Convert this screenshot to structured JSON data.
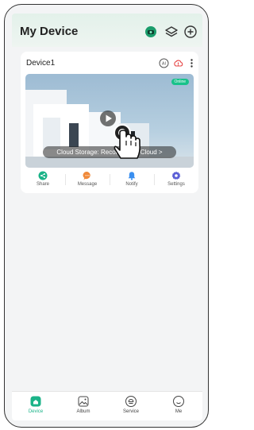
{
  "header": {
    "title": "My Device",
    "icons": [
      "device-status-icon",
      "layers-icon",
      "add-icon"
    ]
  },
  "device_card": {
    "name": "Device1",
    "icons": [
      "ai-icon",
      "cloud-alert-icon",
      "more-icon"
    ],
    "status_badge": "Online",
    "cloud_storage_text": "Cloud Storage: Recording on Cloud >",
    "actions": [
      {
        "label": "Share",
        "icon": "share-icon",
        "color": "#1bb388"
      },
      {
        "label": "Message",
        "icon": "message-icon",
        "color": "#f08a3a"
      },
      {
        "label": "Notify",
        "icon": "bell-icon",
        "color": "#3a8ff0"
      },
      {
        "label": "Settings",
        "icon": "gear-icon",
        "color": "#5b5fd6"
      }
    ]
  },
  "tabbar": {
    "tabs": [
      {
        "label": "Device",
        "icon": "home-icon",
        "active": true
      },
      {
        "label": "Album",
        "icon": "album-icon",
        "active": false
      },
      {
        "label": "Service",
        "icon": "service-icon",
        "active": false
      },
      {
        "label": "Me",
        "icon": "profile-icon",
        "active": false
      }
    ]
  },
  "colors": {
    "accent": "#1bb388",
    "header_bg": "#e3f1ea",
    "page_bg": "#f3f4f5"
  }
}
